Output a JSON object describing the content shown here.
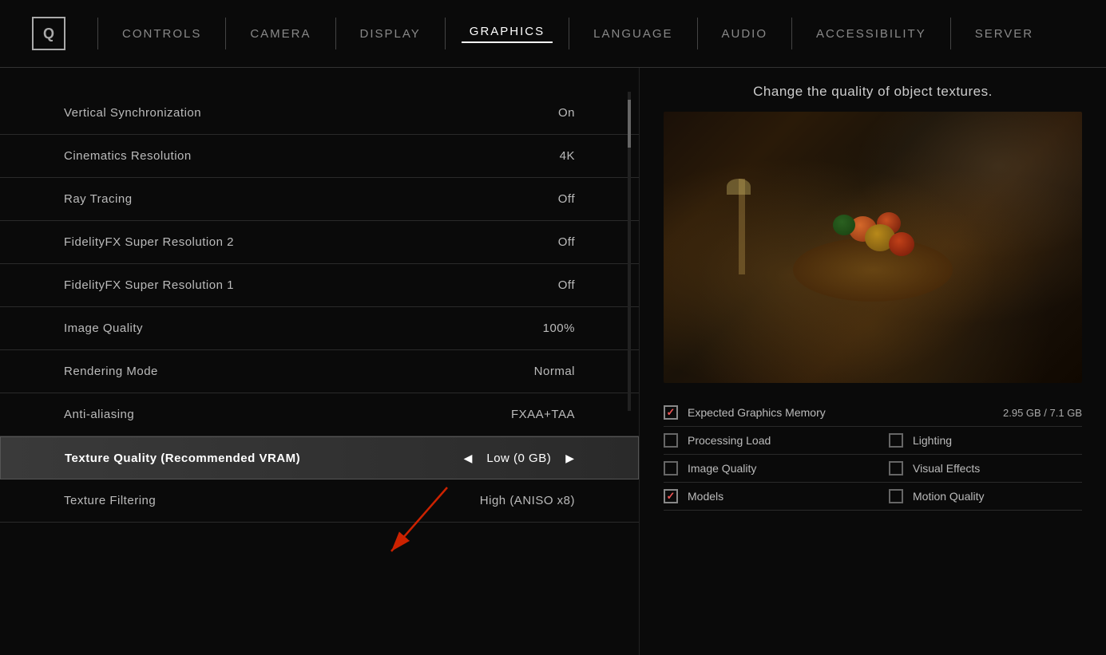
{
  "nav": {
    "logo": "Q",
    "items": [
      {
        "id": "controls",
        "label": "CONTROLS",
        "active": false
      },
      {
        "id": "camera",
        "label": "CAMERA",
        "active": false
      },
      {
        "id": "display",
        "label": "DISPLAY",
        "active": false
      },
      {
        "id": "graphics",
        "label": "GRAPHICS",
        "active": true
      },
      {
        "id": "language",
        "label": "LANGUAGE",
        "active": false
      },
      {
        "id": "audio",
        "label": "AUDIO",
        "active": false
      },
      {
        "id": "accessibility",
        "label": "ACCESSIBILITY",
        "active": false
      },
      {
        "id": "server",
        "label": "SERVER",
        "active": false
      }
    ]
  },
  "settings": {
    "rows": [
      {
        "name": "Vertical Synchronization",
        "value": "On",
        "highlighted": false
      },
      {
        "name": "Cinematics Resolution",
        "value": "4K",
        "highlighted": false
      },
      {
        "name": "Ray Tracing",
        "value": "Off",
        "highlighted": false
      },
      {
        "name": "FidelityFX Super Resolution 2",
        "value": "Off",
        "highlighted": false
      },
      {
        "name": "FidelityFX Super Resolution 1",
        "value": "Off",
        "highlighted": false
      },
      {
        "name": "Image Quality",
        "value": "100%",
        "highlighted": false
      },
      {
        "name": "Rendering Mode",
        "value": "Normal",
        "highlighted": false
      },
      {
        "name": "Anti-aliasing",
        "value": "FXAA+TAA",
        "highlighted": false
      },
      {
        "name": "Texture Quality (Recommended VRAM)",
        "value": "Low (0 GB)",
        "highlighted": true
      },
      {
        "name": "Texture Filtering",
        "value": "High (ANISO x8)",
        "highlighted": false
      }
    ]
  },
  "preview": {
    "description": "Change the quality of object textures.",
    "memory_label": "Expected Graphics Memory",
    "memory_value": "2.95 GB / 7.1 GB",
    "checkboxes": [
      {
        "id": "processing_load",
        "label": "Processing Load",
        "checked": false,
        "col": "left"
      },
      {
        "id": "lighting",
        "label": "Lighting",
        "checked": false,
        "col": "right"
      },
      {
        "id": "image_quality",
        "label": "Image Quality",
        "checked": false,
        "col": "left"
      },
      {
        "id": "visual_effects",
        "label": "Visual Effects",
        "checked": false,
        "col": "right"
      },
      {
        "id": "models",
        "label": "Models",
        "checked": true,
        "col": "left"
      },
      {
        "id": "motion_quality",
        "label": "Motion Quality",
        "checked": false,
        "col": "right"
      }
    ]
  },
  "arrows": {
    "left": "◀",
    "right": "▶"
  }
}
